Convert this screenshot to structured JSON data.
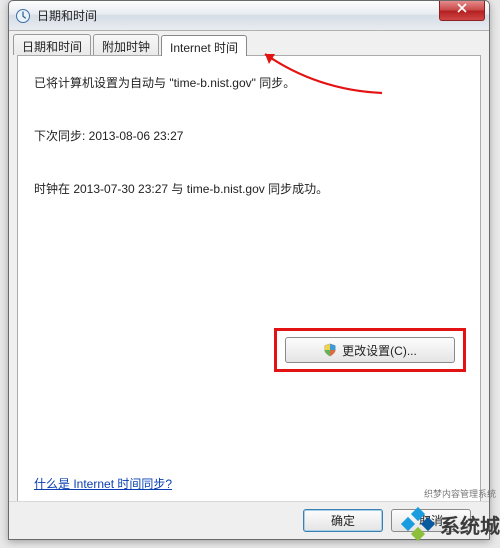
{
  "window": {
    "title": "日期和时间"
  },
  "tabs": {
    "items": [
      {
        "label": "日期和时间"
      },
      {
        "label": "附加时钟"
      },
      {
        "label": "Internet 时间"
      }
    ],
    "active_index": 2
  },
  "content": {
    "sync_config": "已将计算机设置为自动与 \"time-b.nist.gov\" 同步。",
    "next_sync": "下次同步: 2013-08-06 23:27",
    "last_status": "时钟在 2013-07-30 23:27 与 time-b.nist.gov 同步成功。",
    "change_button": "更改设置(C)...",
    "help_link": "什么是 Internet 时间同步?"
  },
  "footer": {
    "ok": "确定",
    "cancel": "取消"
  },
  "annotation": {
    "highlight_color": "#e31313"
  },
  "watermark": {
    "text": "系统城",
    "sub": "织梦内容管理系统"
  }
}
